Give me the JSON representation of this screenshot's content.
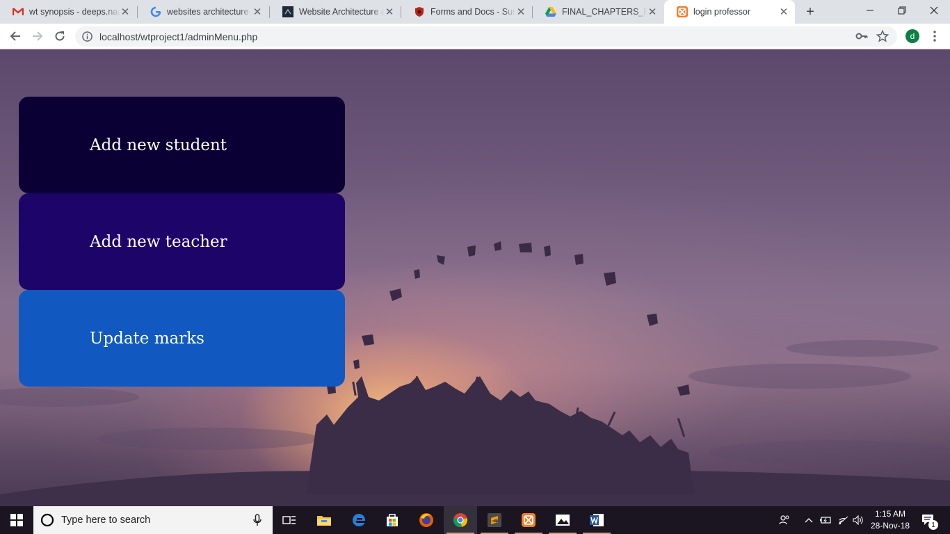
{
  "browser": {
    "tabs": [
      {
        "title": "wt synopsis - deeps.nag",
        "icon": "gmail-icon"
      },
      {
        "title": "websites architecture - ",
        "icon": "google-icon"
      },
      {
        "title": "Website Architecture &",
        "icon": "website-icon"
      },
      {
        "title": "Forms and Docs - Suma",
        "icon": "docs-shield-icon"
      },
      {
        "title": "FINAL_CHAPTERS_PAGE",
        "icon": "google-drive-icon"
      },
      {
        "title": "login professor",
        "icon": "xampp-icon",
        "active": true
      }
    ],
    "url": "localhost/wtproject1/adminMenu.php",
    "profile_initial": "d"
  },
  "menu": {
    "add_student": "Add new student",
    "add_teacher": "Add new teacher",
    "update_marks": "Update marks"
  },
  "colors": {
    "add_student_bg": "#0b0033",
    "add_teacher_bg": "#1d0469",
    "update_marks_bg": "#1159c0"
  },
  "taskbar": {
    "search_placeholder": "Type here to search",
    "time": "1:15 AM",
    "date": "28-Nov-18",
    "notification_count": "1",
    "apps": [
      "task-view-icon",
      "file-explorer-icon",
      "edge-icon",
      "store-icon",
      "firefox-icon",
      "chrome-icon",
      "sublime-text-icon",
      "xampp-icon",
      "photos-icon",
      "word-icon"
    ]
  }
}
